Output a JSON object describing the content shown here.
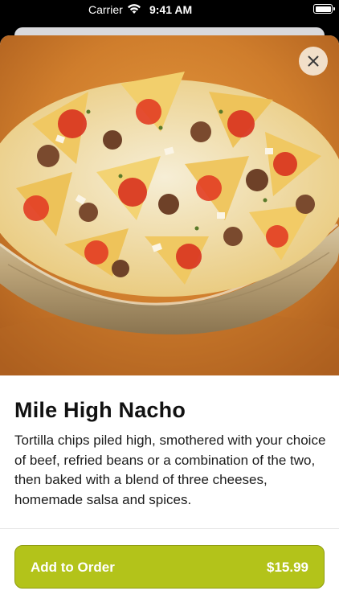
{
  "status_bar": {
    "carrier": "Carrier",
    "time": "9:41 AM"
  },
  "item": {
    "title": "Mile High Nacho",
    "description": "Tortilla chips piled high, smothered with your choice of beef, refried beans or a combination of the two, then baked with a blend of three cheeses, homemade salsa and spices.",
    "image_icon": "nachos-photo"
  },
  "actions": {
    "close_icon": "close-icon",
    "add_label": "Add to Order",
    "price": "$15.99"
  },
  "colors": {
    "accent": "#b3c31a",
    "accent_border": "#8f9c10",
    "title_text": "#111111",
    "body_text": "#1c1c1c"
  }
}
